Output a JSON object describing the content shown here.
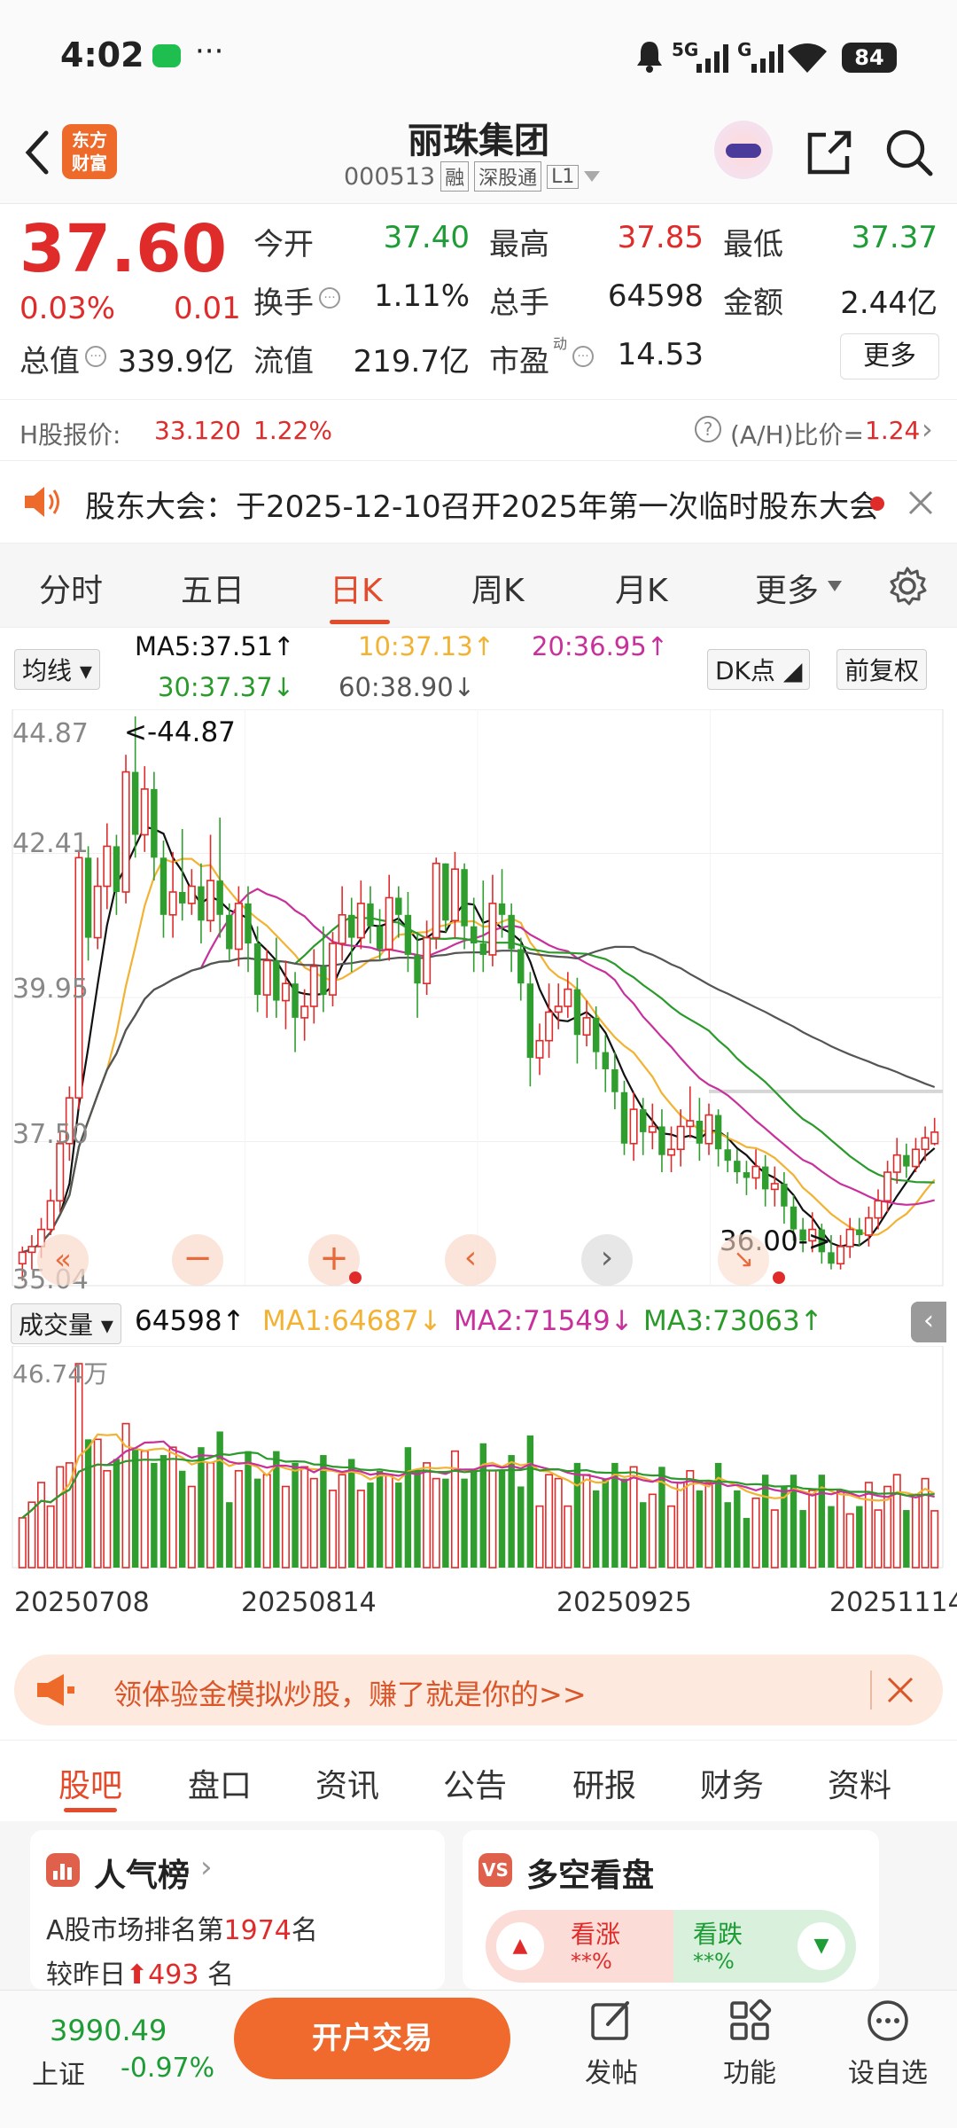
{
  "status_bar": {
    "time": "4:02",
    "dots": "···",
    "signal_1": "5G",
    "signal_2": "G",
    "battery": "84"
  },
  "header": {
    "logo_line1": "东方",
    "logo_line2": "财富",
    "stock_name": "丽珠集团",
    "stock_code": "000513",
    "tag_margin": "融",
    "tag_connect": "深股通",
    "tag_level": "L1"
  },
  "quote": {
    "price": "37.60",
    "change_pct": "0.03%",
    "change_abs": "0.01",
    "open_label": "今开",
    "open_value": "37.40",
    "high_label": "最高",
    "high_value": "37.85",
    "low_label": "最低",
    "low_value": "37.37",
    "turnover_label": "换手",
    "turnover_value": "1.11%",
    "volume_label": "总手",
    "volume_value": "64598",
    "amount_label": "金额",
    "amount_value": "2.44亿",
    "mktcap_label": "总值",
    "mktcap_value": "339.9亿",
    "float_label": "流值",
    "float_value": "219.7亿",
    "pe_label": "市盈",
    "pe_sup": "动",
    "pe_value": "14.53",
    "more_label": "更多"
  },
  "hshare": {
    "label": "H股报价:",
    "price": "33.120",
    "pct": "1.22%",
    "ratio_label": "(A/H)比价=",
    "ratio_value": "1.24"
  },
  "notice": {
    "text": "股东大会：于2025-12-10召开2025年第一次临时股东大会"
  },
  "chart_tabs": [
    "分时",
    "五日",
    "日K",
    "周K",
    "月K",
    "更多"
  ],
  "ma_legend": {
    "selector": "均线",
    "ma5": "MA5:37.51↑",
    "ma10": "10:37.13↑",
    "ma20": "20:36.95↑",
    "ma30": "30:37.37↓",
    "ma60": "60:38.90↓",
    "dk": "DK点",
    "adjust": "前复权"
  },
  "chart_labels": {
    "y_top": "44.87",
    "y_2": "42.41",
    "y_3": "39.95",
    "y_4": "37.50",
    "y_bottom": "35.04",
    "high_marker": "<-44.87",
    "low_marker": "36.00->"
  },
  "volume_legend": {
    "selector": "成交量",
    "vol": "64598↑",
    "ma1": "MA1:64687↓",
    "ma2": "MA2:71549↓",
    "ma3": "MA3:73063↑",
    "max_label": "46.74万"
  },
  "dates": [
    "20250708",
    "20250814",
    "20250925",
    "20251114"
  ],
  "promo": {
    "text": "领体验金模拟炒股，赚了就是你的>>"
  },
  "info_tabs": [
    "股吧",
    "盘口",
    "资讯",
    "公告",
    "研报",
    "财务",
    "资料"
  ],
  "cards": {
    "popularity_title": "人气榜",
    "popularity_rank_prefix": "A股市场排名第",
    "popularity_rank": "1974",
    "popularity_rank_suffix": "名",
    "popularity_change_prefix": "较昨日",
    "popularity_change": "493",
    "popularity_change_suffix": "名",
    "sentiment_title": "多空看盘",
    "bull_label": "看涨",
    "bull_pct": "**%",
    "bear_label": "看跌",
    "bear_pct": "**%"
  },
  "bottom_bar": {
    "index_value": "3990.49",
    "index_name": "上证",
    "index_pct": "-0.97%",
    "trade_label": "开户交易",
    "post_label": "发帖",
    "func_label": "功能",
    "watch_label": "设自选"
  },
  "chart_data": {
    "type": "candlestick",
    "y_range": [
      35.04,
      44.87
    ],
    "x_start": "20250708",
    "x_end": "20251114",
    "candles": [
      [
        35.3,
        35.5,
        35.0,
        35.6
      ],
      [
        35.5,
        35.6,
        35.2,
        35.8
      ],
      [
        35.6,
        35.9,
        35.4,
        36.1
      ],
      [
        35.9,
        36.4,
        35.8,
        36.6
      ],
      [
        36.4,
        37.4,
        36.2,
        37.6
      ],
      [
        37.4,
        38.2,
        37.1,
        38.4
      ],
      [
        38.2,
        42.4,
        38.0,
        42.5
      ],
      [
        42.4,
        41.0,
        40.6,
        42.6
      ],
      [
        41.0,
        41.9,
        40.8,
        42.4
      ],
      [
        41.9,
        42.6,
        41.5,
        43.0
      ],
      [
        42.6,
        41.8,
        41.4,
        42.8
      ],
      [
        41.8,
        43.9,
        41.6,
        44.2
      ],
      [
        43.9,
        42.8,
        42.4,
        44.87
      ],
      [
        42.8,
        43.6,
        42.5,
        44.0
      ],
      [
        43.6,
        42.4,
        42.0,
        43.9
      ],
      [
        42.4,
        41.4,
        41.0,
        42.7
      ],
      [
        41.4,
        41.8,
        41.0,
        42.5
      ],
      [
        41.8,
        41.6,
        41.3,
        42.9
      ],
      [
        41.6,
        41.9,
        41.4,
        42.2
      ],
      [
        41.9,
        41.3,
        40.9,
        42.3
      ],
      [
        41.3,
        42.0,
        41.1,
        42.8
      ],
      [
        42.0,
        41.4,
        41.0,
        43.1
      ],
      [
        41.4,
        40.8,
        40.6,
        41.6
      ],
      [
        40.8,
        41.6,
        40.5,
        41.9
      ],
      [
        41.6,
        40.9,
        40.4,
        41.9
      ],
      [
        40.9,
        40.0,
        39.7,
        41.2
      ],
      [
        40.0,
        40.6,
        39.6,
        40.8
      ],
      [
        40.6,
        39.9,
        39.6,
        41.0
      ],
      [
        39.9,
        40.2,
        39.4,
        40.6
      ],
      [
        40.2,
        39.6,
        39.0,
        40.4
      ],
      [
        39.6,
        39.8,
        39.2,
        40.1
      ],
      [
        39.8,
        40.5,
        39.5,
        40.8
      ],
      [
        40.5,
        40.0,
        39.7,
        41.2
      ],
      [
        40.0,
        40.9,
        39.8,
        41.1
      ],
      [
        40.9,
        41.4,
        40.6,
        41.9
      ],
      [
        41.4,
        41.0,
        40.4,
        41.7
      ],
      [
        41.0,
        41.6,
        40.8,
        42.0
      ],
      [
        41.6,
        41.2,
        40.9,
        41.9
      ],
      [
        41.2,
        40.8,
        40.6,
        41.5
      ],
      [
        40.8,
        41.7,
        40.6,
        42.1
      ],
      [
        41.7,
        41.4,
        41.0,
        41.9
      ],
      [
        41.4,
        40.7,
        40.4,
        41.8
      ],
      [
        40.7,
        40.2,
        39.6,
        41.1
      ],
      [
        40.2,
        41.0,
        40.0,
        41.3
      ],
      [
        41.0,
        42.3,
        40.8,
        42.4
      ],
      [
        42.3,
        41.3,
        41.1,
        42.3
      ],
      [
        41.3,
        42.2,
        41.0,
        42.5
      ],
      [
        42.2,
        41.2,
        40.8,
        42.3
      ],
      [
        41.2,
        40.9,
        40.4,
        41.7
      ],
      [
        40.9,
        40.7,
        40.4,
        42.0
      ],
      [
        40.7,
        41.6,
        40.5,
        42.1
      ],
      [
        41.6,
        41.4,
        41.0,
        42.2
      ],
      [
        41.4,
        40.8,
        40.4,
        41.6
      ],
      [
        40.8,
        40.2,
        39.9,
        41.0
      ],
      [
        40.2,
        38.9,
        38.4,
        40.4
      ],
      [
        38.9,
        39.2,
        38.6,
        39.5
      ],
      [
        39.2,
        39.7,
        38.9,
        40.2
      ],
      [
        39.7,
        39.8,
        39.4,
        40.2
      ],
      [
        39.8,
        40.1,
        39.6,
        40.4
      ],
      [
        40.1,
        39.3,
        38.8,
        40.3
      ],
      [
        39.3,
        39.6,
        39.1,
        39.9
      ],
      [
        39.6,
        39.0,
        38.7,
        39.8
      ],
      [
        39.0,
        38.7,
        38.3,
        39.3
      ],
      [
        38.7,
        38.3,
        38.0,
        39.0
      ],
      [
        38.3,
        37.4,
        37.2,
        38.5
      ],
      [
        37.4,
        38.0,
        37.1,
        38.3
      ],
      [
        38.0,
        37.6,
        37.2,
        38.2
      ],
      [
        37.6,
        37.7,
        37.3,
        38.1
      ],
      [
        37.7,
        37.2,
        36.9,
        38.0
      ],
      [
        37.2,
        37.3,
        36.9,
        37.7
      ],
      [
        37.3,
        37.7,
        37.0,
        38.0
      ],
      [
        37.7,
        37.8,
        37.5,
        38.4
      ],
      [
        37.8,
        37.4,
        37.1,
        38.2
      ],
      [
        37.4,
        37.9,
        37.2,
        38.1
      ],
      [
        37.9,
        37.3,
        37.0,
        38.0
      ],
      [
        37.3,
        37.1,
        36.9,
        37.6
      ],
      [
        37.1,
        36.9,
        36.7,
        37.3
      ],
      [
        36.9,
        36.8,
        36.5,
        37.1
      ],
      [
        36.8,
        37.0,
        36.6,
        37.3
      ],
      [
        37.0,
        36.6,
        36.3,
        37.2
      ],
      [
        36.6,
        36.7,
        36.3,
        37.0
      ],
      [
        36.7,
        36.3,
        36.0,
        36.9
      ],
      [
        36.3,
        35.9,
        35.7,
        36.5
      ],
      [
        35.9,
        35.7,
        35.5,
        36.1
      ],
      [
        35.7,
        35.9,
        35.5,
        36.2
      ],
      [
        35.9,
        35.5,
        35.3,
        36.0
      ],
      [
        35.5,
        35.3,
        35.2,
        35.8
      ],
      [
        35.3,
        35.6,
        35.2,
        35.8
      ],
      [
        35.6,
        35.9,
        35.4,
        36.1
      ],
      [
        35.9,
        35.8,
        35.6,
        36.1
      ],
      [
        35.8,
        36.1,
        35.6,
        36.3
      ],
      [
        36.1,
        36.4,
        35.9,
        36.6
      ],
      [
        36.4,
        36.9,
        36.2,
        37.1
      ],
      [
        36.9,
        37.2,
        36.7,
        37.5
      ],
      [
        37.2,
        37.0,
        36.8,
        37.4
      ],
      [
        37.0,
        37.3,
        36.9,
        37.5
      ],
      [
        37.3,
        37.5,
        37.1,
        37.7
      ],
      [
        37.4,
        37.6,
        37.37,
        37.85
      ]
    ],
    "ma_series": [
      {
        "name": "MA5",
        "color": "#111111"
      },
      {
        "name": "MA10",
        "color": "#f2b233"
      },
      {
        "name": "MA20",
        "color": "#c8309c"
      },
      {
        "name": "MA30",
        "color": "#2a9a2a"
      },
      {
        "name": "MA60",
        "color": "#555555"
      }
    ],
    "volume_max": 467400,
    "volume_unit": "万",
    "colors": {
      "up": "#e02b2b",
      "down": "#2f9e2f"
    }
  }
}
